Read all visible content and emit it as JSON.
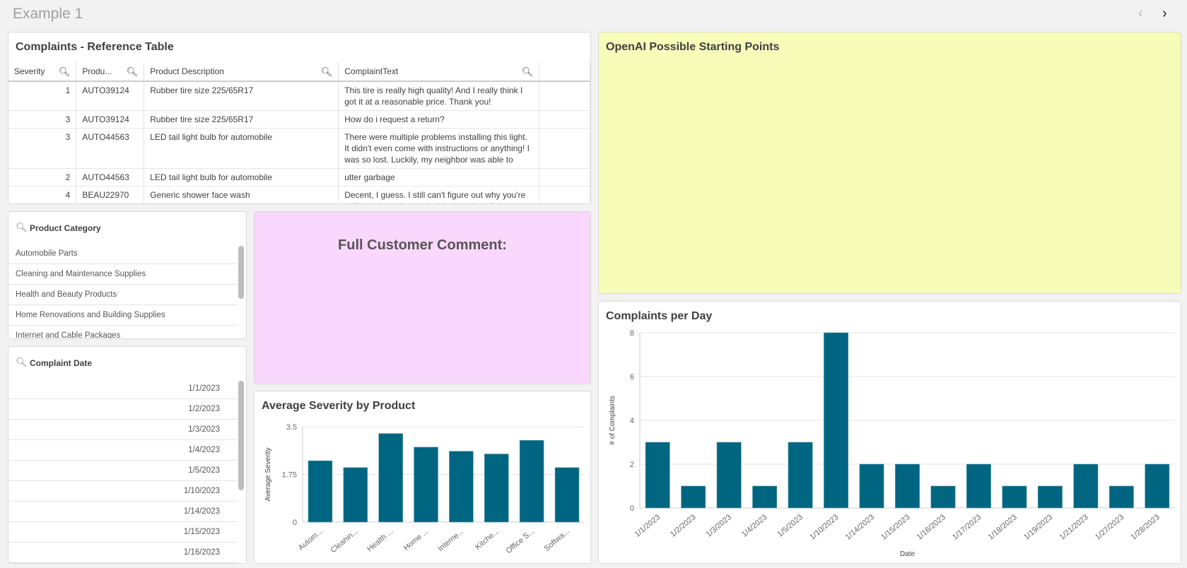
{
  "header": {
    "title": "Example 1",
    "prev_icon": "chevron-left-icon",
    "next_icon": "chevron-right-icon"
  },
  "table": {
    "title": "Complaints - Reference Table",
    "columns": [
      "Severity",
      "Produ...",
      "Product Description",
      "ComplaintText"
    ],
    "rows": [
      {
        "severity": "1",
        "product": "AUTO39124",
        "description": "Rubber tire size 225/65R17",
        "text": "This tire is really high quality! And I really think I got it at a reasonable price. Thank you!"
      },
      {
        "severity": "3",
        "product": "AUTO39124",
        "description": "Rubber tire size 225/65R17",
        "text": "How do i request a return?"
      },
      {
        "severity": "3",
        "product": "AUTO44563",
        "description": "LED tail light bulb for automobile",
        "text": "There were multiple problems installing this light. It didn't even come with instructions or anything! I was so lost. Luckily, my neighbor was able to"
      },
      {
        "severity": "2",
        "product": "AUTO44563",
        "description": "LED tail light bulb for automobile",
        "text": "utter garbage"
      },
      {
        "severity": "4",
        "product": "BEAU22970",
        "description": "Generic shower face wash",
        "text": "Decent, I guess. I still can't figure out why you're selling this at almost double the price of the"
      }
    ]
  },
  "openai": {
    "title": "OpenAI Possible Starting Points",
    "bg": "#f7fcb9"
  },
  "comment": {
    "title": "Full Customer Comment:",
    "bg": "#fad7fd"
  },
  "product_category": {
    "title": "Product Category",
    "items": [
      "Automobile Parts",
      "Cleaning and Maintenance Supplies",
      "Health and Beauty Products",
      "Home Renovations and Building Supplies",
      "Internet and Cable Packages"
    ]
  },
  "complaint_date": {
    "title": "Complaint Date",
    "items": [
      "1/1/2023",
      "1/2/2023",
      "1/3/2023",
      "1/4/2023",
      "1/5/2023",
      "1/10/2023",
      "1/14/2023",
      "1/15/2023",
      "1/16/2023"
    ]
  },
  "chart_data": [
    {
      "type": "bar",
      "title": "Average Severity by Product",
      "xlabel": "",
      "ylabel": "Average Severity",
      "ylim": [
        0,
        3.5
      ],
      "yticks": [
        "0",
        "1.75",
        "3.5"
      ],
      "grid": true,
      "color": "#006580",
      "categories": [
        "Autom...",
        "Cleanin...",
        "Health ...",
        "Home ...",
        "Interne...",
        "Kitche...",
        "Office S...",
        "Softwa..."
      ],
      "values": [
        2.25,
        2.0,
        3.25,
        2.75,
        2.6,
        2.5,
        3.0,
        2.0
      ]
    },
    {
      "type": "bar",
      "title": "Complaints per Day",
      "xlabel": "Date",
      "ylabel": "# of Complaints",
      "ylim": [
        0,
        8
      ],
      "yticks": [
        "0",
        "2",
        "4",
        "6",
        "8"
      ],
      "grid": true,
      "color": "#006580",
      "categories": [
        "1/1/2023",
        "1/2/2023",
        "1/3/2023",
        "1/4/2023",
        "1/5/2023",
        "1/10/2023",
        "1/14/2023",
        "1/15/2023",
        "1/16/2023",
        "1/17/2023",
        "1/18/2023",
        "1/19/2023",
        "1/21/2023",
        "1/27/2023",
        "1/28/2023"
      ],
      "values": [
        3,
        1,
        3,
        1,
        3,
        8,
        2,
        2,
        1,
        2,
        1,
        1,
        2,
        1,
        2
      ]
    }
  ]
}
